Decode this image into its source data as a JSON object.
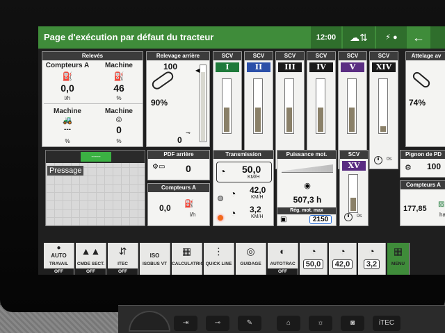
{
  "header": {
    "title": "Page d'exécution par défaut du tracteur",
    "time": "12:00",
    "back_icon": "arrow-left-icon"
  },
  "releves": {
    "title": "Relevés",
    "col1_label": "Compteurs A",
    "col1_value": "0,0",
    "col1_unit": "l/h",
    "col2_label": "Machine",
    "col2_value": "46",
    "col2_unit": "%",
    "col3_label": "Machine",
    "col3_value": "---",
    "col3_unit": "%",
    "col4_label": "Machine",
    "col4_value": "0",
    "col4_unit": "%"
  },
  "relevage": {
    "title": "Relevage arrière",
    "top": "100",
    "bottom": "0",
    "percent": "90%",
    "position_pct": 90
  },
  "scv": [
    {
      "label": "SCV",
      "num": "I",
      "color": "#1f7a3a",
      "fill_pct": 45,
      "flow": "6s"
    },
    {
      "label": "SCV",
      "num": "II",
      "color": "#2b4fa8",
      "fill_pct": 45,
      "flow": "C"
    },
    {
      "label": "SCV",
      "num": "III",
      "color": "#1a1a1a",
      "fill_pct": 45,
      "flow": "C"
    },
    {
      "label": "SCV",
      "num": "IV",
      "color": "#1a1a1a",
      "fill_pct": 45,
      "flow": "C"
    },
    {
      "label": "SCV",
      "num": "V",
      "color": "#5a2d82",
      "fill_pct": 45,
      "flow": ""
    },
    {
      "label": "SCV",
      "num": "XIV",
      "color": "#1a1a1a",
      "fill_pct": 10,
      "flow": "0s"
    }
  ],
  "attelage": {
    "title": "Attelage av",
    "percent": "74%"
  },
  "pressage": {
    "label": "Pressage",
    "counter": "-----"
  },
  "pdf": {
    "title": "PDF arrière",
    "value": "0"
  },
  "compteurs_a": {
    "title": "Compteurs A",
    "value": "0,0",
    "unit": "l/h"
  },
  "transmission": {
    "title": "Transmission",
    "speed": "50,0",
    "speed_unit": "KM/H",
    "gear1": "42,0",
    "gear1_unit": "KM/H",
    "gear2": "3,2",
    "gear2_unit": "KM/H"
  },
  "puissance": {
    "title": "Puissance mot.",
    "hours": "507,3 h",
    "reg_title": "Rég. mot. max",
    "reg_value": "2150"
  },
  "scv_xv": {
    "label": "SCV",
    "num": "XV",
    "color": "#5a2d82",
    "fill_pct": 35,
    "flow": "0s"
  },
  "pignon": {
    "title": "Pignon de PD",
    "value": "100"
  },
  "compteurs_a2": {
    "title": "Compteurs A",
    "value": "177,85",
    "unit": "ha"
  },
  "toolbar": [
    {
      "icon": "auto-travail-icon",
      "label": "TRAVAIL",
      "top": "AUTO",
      "status": "OFF"
    },
    {
      "icon": "cmde-sect-icon",
      "label": "CMDE SECT.",
      "top": "",
      "status": "OFF"
    },
    {
      "icon": "itec-icon",
      "label": "ITEC",
      "top": "",
      "status": "OFF"
    },
    {
      "icon": "iso-icon",
      "label": "ISOBUS VT",
      "top": "ISO",
      "status": ""
    },
    {
      "icon": "calculator-icon",
      "label": "CALCULATRICE",
      "top": "",
      "status": ""
    },
    {
      "icon": "quick-line-icon",
      "label": "QUICK LINE",
      "top": "",
      "status": ""
    },
    {
      "icon": "guidage-icon",
      "label": "GUIDAGE",
      "top": "",
      "status": ""
    },
    {
      "icon": "autotrac-icon",
      "label": "AUTOTRAC",
      "top": "",
      "status": "OFF"
    },
    {
      "icon": "speed-icon",
      "label": "50,0",
      "top": "",
      "status": ""
    },
    {
      "icon": "speed-icon",
      "label": "42,0",
      "top": "",
      "status": ""
    },
    {
      "icon": "speed-icon",
      "label": "3,2",
      "top": "",
      "status": ""
    },
    {
      "icon": "menu-icon",
      "label": "MENU",
      "top": "",
      "status": ""
    }
  ],
  "console": {
    "itec_label": "iTEC"
  }
}
